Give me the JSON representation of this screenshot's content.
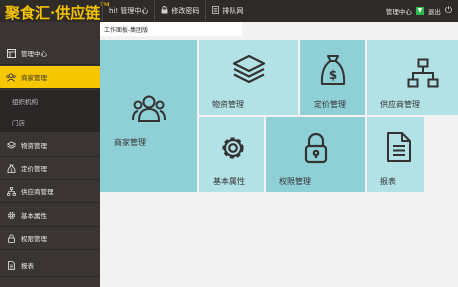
{
  "header": {
    "logo": "聚食汇·供应链",
    "logo_sup": "TM",
    "nav": [
      {
        "icon": "home-icon",
        "label": "hi! 管理中心"
      },
      {
        "icon": "lock-icon",
        "label": "修改密码"
      },
      {
        "icon": "queue-icon",
        "label": "排队网"
      }
    ],
    "right": {
      "admin": "管理中心",
      "badge": "▼",
      "logout": "退出",
      "power_icon": "⏻"
    }
  },
  "breadcrumb": "工作面板-集团版",
  "sidebar": {
    "items": [
      {
        "label": "管理中心"
      },
      {
        "label": "商家管理"
      },
      {
        "label": "物资管理"
      },
      {
        "label": "定价管理"
      },
      {
        "label": "供应商管理"
      },
      {
        "label": "基本属性"
      },
      {
        "label": "权限管理"
      },
      {
        "label": "报表"
      }
    ],
    "sub": [
      "组织机构",
      "门店"
    ]
  },
  "tiles": [
    {
      "label": "商家管理",
      "icon": "users-icon",
      "color": "#8fd0d6"
    },
    {
      "label": "物资管理",
      "icon": "layers-icon",
      "color": "#b3e2e6"
    },
    {
      "label": "定价管理",
      "icon": "money-bag-icon",
      "color": "#8fd0d6"
    },
    {
      "label": "供应商管理",
      "icon": "sitemap-icon",
      "color": "#b3e2e6"
    },
    {
      "label": "基本属性",
      "icon": "gear-icon",
      "color": "#b3e2e6"
    },
    {
      "label": "权限管理",
      "icon": "padlock-icon",
      "color": "#8fd0d6"
    },
    {
      "label": "报表",
      "icon": "document-icon",
      "color": "#b3e2e6"
    }
  ]
}
